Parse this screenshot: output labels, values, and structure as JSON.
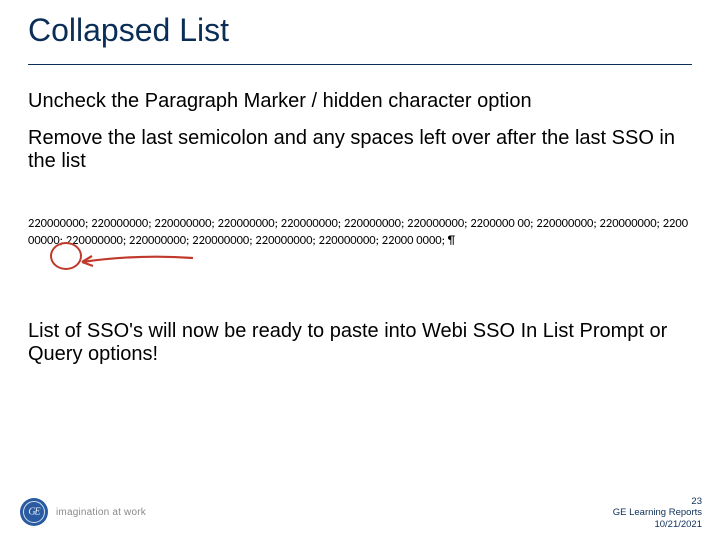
{
  "title": "Collapsed List",
  "para1": "Uncheck the Paragraph Marker / hidden character option",
  "para2": "Remove the last semicolon and any spaces left over after the last SSO in the list",
  "example_text": "220000000; 220000000; 220000000; 220000000; 220000000; 220000000; 220000000; 2200000 00; 220000000; 220000000; 220000000; 220000000; 220000000; 220000000; 220000000; 220000000; 22000 0000; ¶",
  "para3": "List of SSO's will now be ready to paste into Webi SSO In List Prompt or Query options!",
  "logo_text": "GE",
  "tagline": "imagination at work",
  "meta": {
    "page": "23",
    "label": "GE Learning Reports",
    "date": "10/21/2021"
  }
}
